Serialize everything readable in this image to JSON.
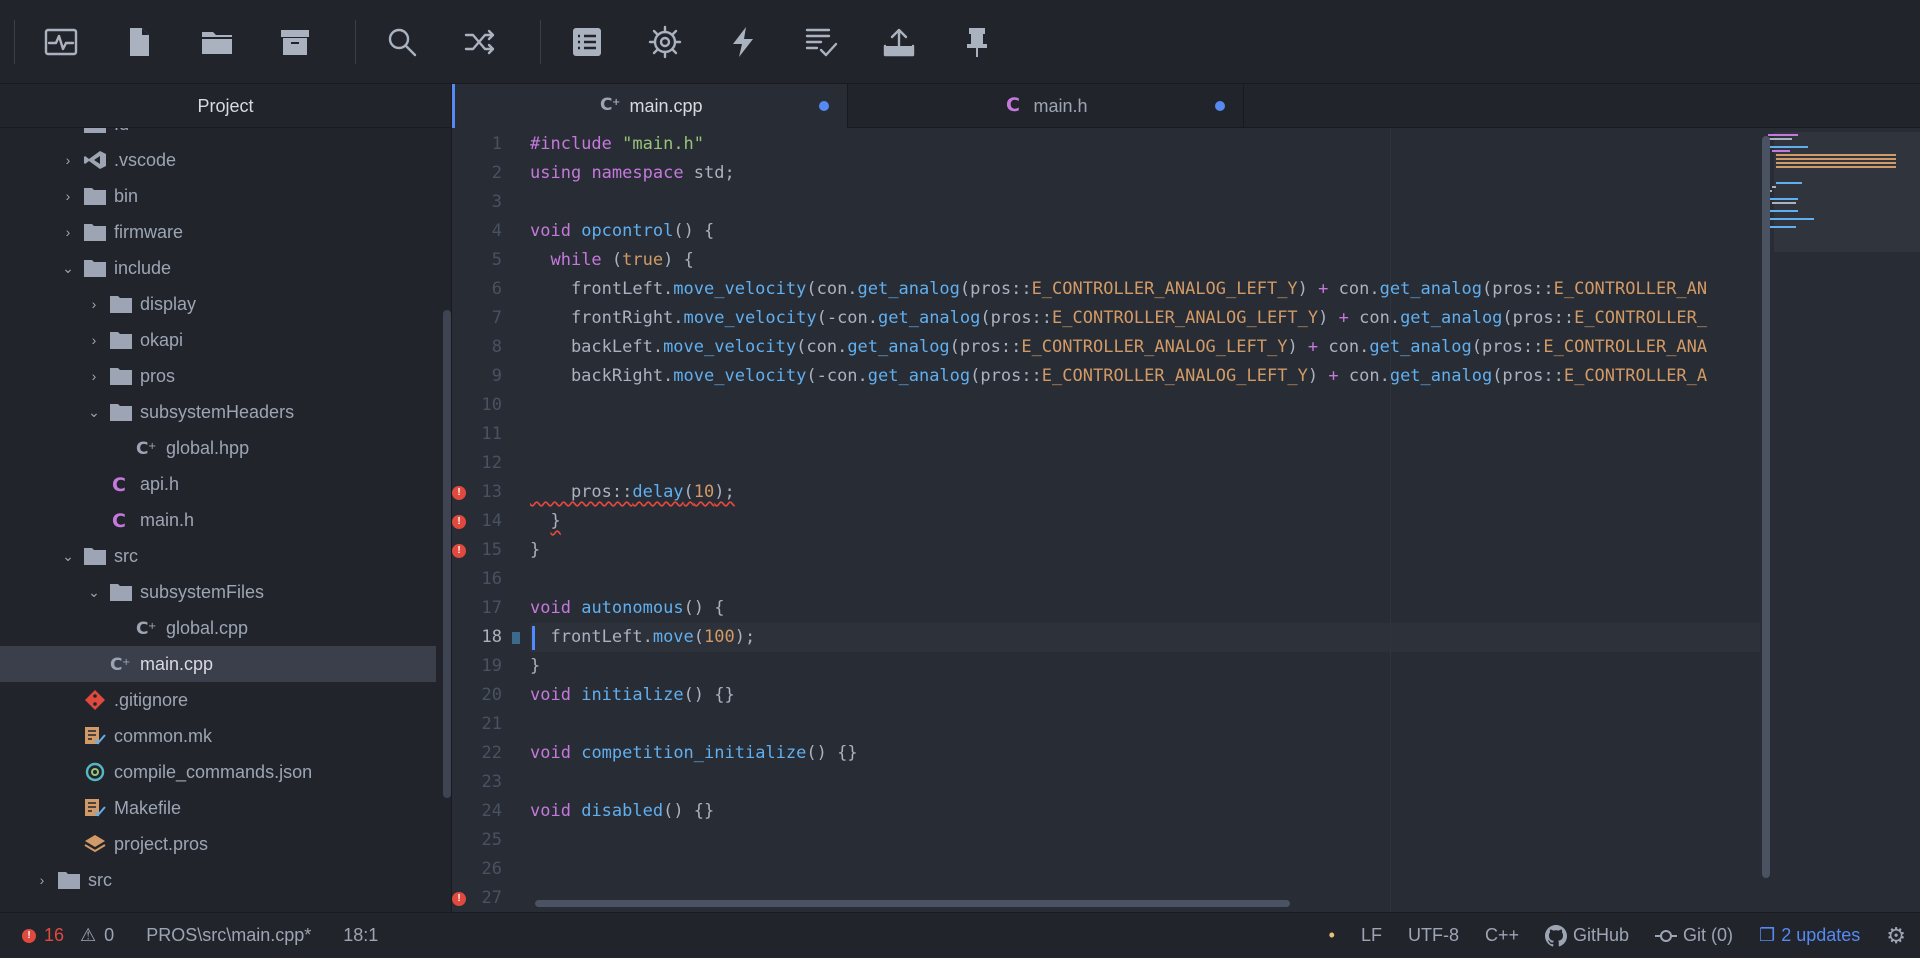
{
  "toolbar": {
    "buttons": [
      {
        "name": "pulse-icon"
      },
      {
        "name": "file-icon"
      },
      {
        "name": "folder-icon"
      },
      {
        "name": "archive-icon"
      },
      {
        "name": "search-icon"
      },
      {
        "name": "shuffle-icon"
      },
      {
        "name": "list-icon"
      },
      {
        "name": "gear-icon"
      },
      {
        "name": "lightning-icon"
      },
      {
        "name": "checklist-icon"
      },
      {
        "name": "upload-icon"
      },
      {
        "name": "pin-icon"
      }
    ]
  },
  "sidebar": {
    "title": "Project",
    "items": [
      {
        "label": ".d",
        "indent": 0,
        "chevron": "›",
        "icon": "folder"
      },
      {
        "label": ".vscode",
        "indent": 0,
        "chevron": "›",
        "icon": "vscode"
      },
      {
        "label": "bin",
        "indent": 0,
        "chevron": "›",
        "icon": "folder"
      },
      {
        "label": "firmware",
        "indent": 0,
        "chevron": "›",
        "icon": "folder"
      },
      {
        "label": "include",
        "indent": 0,
        "chevron": "⌄",
        "icon": "folder"
      },
      {
        "label": "display",
        "indent": 1,
        "chevron": "›",
        "icon": "folder"
      },
      {
        "label": "okapi",
        "indent": 1,
        "chevron": "›",
        "icon": "folder"
      },
      {
        "label": "pros",
        "indent": 1,
        "chevron": "›",
        "icon": "folder"
      },
      {
        "label": "subsystemHeaders",
        "indent": 1,
        "chevron": "⌄",
        "icon": "folder"
      },
      {
        "label": "global.hpp",
        "indent": 2,
        "chevron": "",
        "icon": "cpp"
      },
      {
        "label": "api.h",
        "indent": 1,
        "chevron": "",
        "icon": "c"
      },
      {
        "label": "main.h",
        "indent": 1,
        "chevron": "",
        "icon": "c"
      },
      {
        "label": "src",
        "indent": 0,
        "chevron": "⌄",
        "icon": "folder"
      },
      {
        "label": "subsystemFiles",
        "indent": 1,
        "chevron": "⌄",
        "icon": "folder"
      },
      {
        "label": "global.cpp",
        "indent": 2,
        "chevron": "",
        "icon": "cpp"
      },
      {
        "label": "main.cpp",
        "indent": 1,
        "chevron": "",
        "icon": "cpp",
        "selected": true
      },
      {
        "label": ".gitignore",
        "indent": 0,
        "chevron": "",
        "icon": "git"
      },
      {
        "label": "common.mk",
        "indent": 0,
        "chevron": "",
        "icon": "make"
      },
      {
        "label": "compile_commands.json",
        "indent": 0,
        "chevron": "",
        "icon": "json"
      },
      {
        "label": "Makefile",
        "indent": 0,
        "chevron": "",
        "icon": "make"
      },
      {
        "label": "project.pros",
        "indent": 0,
        "chevron": "",
        "icon": "pros"
      },
      {
        "label": "src",
        "indent": -1,
        "chevron": "›",
        "icon": "folder"
      }
    ]
  },
  "tabs": [
    {
      "label": "main.cpp",
      "icon": "cpp",
      "active": true,
      "modified": true
    },
    {
      "label": "main.h",
      "icon": "c",
      "active": false,
      "modified": true
    }
  ],
  "editor": {
    "current_line": 18,
    "error_lines": [
      13,
      14,
      15,
      27
    ],
    "lines": [
      [
        [
          "k",
          "#include"
        ],
        [
          "p",
          " "
        ],
        [
          "s",
          "\"main.h\""
        ]
      ],
      [
        [
          "k",
          "using"
        ],
        [
          "p",
          " "
        ],
        [
          "k",
          "namespace"
        ],
        [
          "p",
          " std;"
        ]
      ],
      [],
      [
        [
          "k",
          "void"
        ],
        [
          "p",
          " "
        ],
        [
          "f",
          "opcontrol"
        ],
        [
          "p",
          "() {"
        ]
      ],
      [
        [
          "p",
          "  "
        ],
        [
          "k",
          "while"
        ],
        [
          "p",
          " ("
        ],
        [
          "n",
          "true"
        ],
        [
          "p",
          ") {"
        ]
      ],
      [
        [
          "p",
          "    frontLeft."
        ],
        [
          "f",
          "move_velocity"
        ],
        [
          "p",
          "(con."
        ],
        [
          "f",
          "get_analog"
        ],
        [
          "p",
          "(pros::"
        ],
        [
          "n",
          "E_CONTROLLER_ANALOG_LEFT_Y"
        ],
        [
          "p",
          ") "
        ],
        [
          "o",
          "+"
        ],
        [
          "p",
          " con."
        ],
        [
          "f",
          "get_analog"
        ],
        [
          "p",
          "(pros::"
        ],
        [
          "n",
          "E_CONTROLLER_AN"
        ]
      ],
      [
        [
          "p",
          "    frontRight."
        ],
        [
          "f",
          "move_velocity"
        ],
        [
          "p",
          "(-con."
        ],
        [
          "f",
          "get_analog"
        ],
        [
          "p",
          "(pros::"
        ],
        [
          "n",
          "E_CONTROLLER_ANALOG_LEFT_Y"
        ],
        [
          "p",
          ") "
        ],
        [
          "o",
          "+"
        ],
        [
          "p",
          " con."
        ],
        [
          "f",
          "get_analog"
        ],
        [
          "p",
          "(pros::"
        ],
        [
          "n",
          "E_CONTROLLER_"
        ]
      ],
      [
        [
          "p",
          "    backLeft."
        ],
        [
          "f",
          "move_velocity"
        ],
        [
          "p",
          "(con."
        ],
        [
          "f",
          "get_analog"
        ],
        [
          "p",
          "(pros::"
        ],
        [
          "n",
          "E_CONTROLLER_ANALOG_LEFT_Y"
        ],
        [
          "p",
          ") "
        ],
        [
          "o",
          "+"
        ],
        [
          "p",
          " con."
        ],
        [
          "f",
          "get_analog"
        ],
        [
          "p",
          "(pros::"
        ],
        [
          "n",
          "E_CONTROLLER_ANA"
        ]
      ],
      [
        [
          "p",
          "    backRight."
        ],
        [
          "f",
          "move_velocity"
        ],
        [
          "p",
          "(-con."
        ],
        [
          "f",
          "get_analog"
        ],
        [
          "p",
          "(pros::"
        ],
        [
          "n",
          "E_CONTROLLER_ANALOG_LEFT_Y"
        ],
        [
          "p",
          ") "
        ],
        [
          "o",
          "+"
        ],
        [
          "p",
          " con."
        ],
        [
          "f",
          "get_analog"
        ],
        [
          "p",
          "(pros::"
        ],
        [
          "n",
          "E_CONTROLLER_A"
        ]
      ],
      [],
      [],
      [],
      [
        [
          "w",
          "    pros::"
        ],
        [
          "wf",
          "delay"
        ],
        [
          "w",
          "("
        ],
        [
          "wn",
          "10"
        ],
        [
          "w",
          ");"
        ]
      ],
      [
        [
          "p",
          "  "
        ],
        [
          "w",
          "}"
        ]
      ],
      [
        [
          "p",
          "}"
        ]
      ],
      [],
      [
        [
          "k",
          "void"
        ],
        [
          "p",
          " "
        ],
        [
          "f",
          "autonomous"
        ],
        [
          "p",
          "() {"
        ]
      ],
      [
        [
          "p",
          "  frontLeft."
        ],
        [
          "f",
          "move"
        ],
        [
          "p",
          "("
        ],
        [
          "n",
          "100"
        ],
        [
          "p",
          ");"
        ]
      ],
      [
        [
          "p",
          "}"
        ]
      ],
      [
        [
          "k",
          "void"
        ],
        [
          "p",
          " "
        ],
        [
          "f",
          "initialize"
        ],
        [
          "p",
          "() {}"
        ]
      ],
      [],
      [
        [
          "k",
          "void"
        ],
        [
          "p",
          " "
        ],
        [
          "f",
          "competition_initialize"
        ],
        [
          "p",
          "() {}"
        ]
      ],
      [],
      [
        [
          "k",
          "void"
        ],
        [
          "p",
          " "
        ],
        [
          "f",
          "disabled"
        ],
        [
          "p",
          "() {}"
        ]
      ],
      [],
      [],
      []
    ]
  },
  "status": {
    "errors": "16",
    "warnings": "0",
    "path": "PROS\\src\\main.cpp*",
    "position": "18:1",
    "line_ending": "LF",
    "encoding": "UTF-8",
    "grammar": "C++",
    "github": "GitHub",
    "git": "Git (0)",
    "updates": "2 updates"
  },
  "colors": {
    "accent": "#568af2",
    "error": "#e0493d"
  }
}
